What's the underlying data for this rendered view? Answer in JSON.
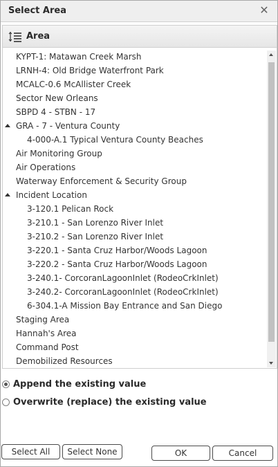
{
  "dialog": {
    "title": "Select Area"
  },
  "panel": {
    "header_label": "Area"
  },
  "tree": [
    {
      "label": "KYPT-1: Matawan Creek Marsh",
      "level": 0,
      "expandable": false
    },
    {
      "label": "LRNH-4: Old Bridge Waterfront Park",
      "level": 0,
      "expandable": false
    },
    {
      "label": "MCALC-0.6 McAllister Creek",
      "level": 0,
      "expandable": false
    },
    {
      "label": "Sector New Orleans",
      "level": 0,
      "expandable": false
    },
    {
      "label": "SBPD 4 - STBN - 17",
      "level": 0,
      "expandable": false
    },
    {
      "label": "GRA - 7 - Ventura County",
      "level": 0,
      "expandable": true,
      "expanded": true
    },
    {
      "label": "4-000-A.1 Typical Ventura County Beaches",
      "level": 1,
      "expandable": false
    },
    {
      "label": "Air Monitoring Group",
      "level": 0,
      "expandable": false
    },
    {
      "label": "Air Operations",
      "level": 0,
      "expandable": false
    },
    {
      "label": "Waterway Enforcement & Security Group",
      "level": 0,
      "expandable": false
    },
    {
      "label": "Incident Location",
      "level": 0,
      "expandable": true,
      "expanded": true
    },
    {
      "label": "3-120.1 Pelican Rock",
      "level": 1,
      "expandable": false
    },
    {
      "label": "3-210.1 - San Lorenzo River Inlet",
      "level": 1,
      "expandable": false
    },
    {
      "label": "3-210.2 - San Lorenzo River Inlet",
      "level": 1,
      "expandable": false
    },
    {
      "label": "3-220.1 - Santa Cruz Harbor/Woods Lagoon",
      "level": 1,
      "expandable": false
    },
    {
      "label": "3-220.2 - Santa Cruz Harbor/Woods Lagoon",
      "level": 1,
      "expandable": false
    },
    {
      "label": "3-240.1- CorcoranLagoonInlet (RodeoCrkInlet)",
      "level": 1,
      "expandable": false
    },
    {
      "label": "3-240.2- CorcoranLagoonInlet (RodeoCrkInlet)",
      "level": 1,
      "expandable": false
    },
    {
      "label": "6-304.1-A Mission Bay Entrance and San Diego",
      "level": 1,
      "expandable": false
    },
    {
      "label": "Staging Area",
      "level": 0,
      "expandable": false
    },
    {
      "label": "Hannah's Area",
      "level": 0,
      "expandable": false
    },
    {
      "label": "Command Post",
      "level": 0,
      "expandable": false
    },
    {
      "label": "Demobilized Resources",
      "level": 0,
      "expandable": false
    }
  ],
  "options": {
    "append_label": "Append the existing value",
    "overwrite_label": "Overwrite (replace) the existing value",
    "selected": "append"
  },
  "buttons": {
    "select_all": "Select All",
    "select_none": "Select None",
    "ok": "OK",
    "cancel": "Cancel"
  },
  "icons": {
    "close": "close-icon",
    "header": "indent-list-icon"
  }
}
